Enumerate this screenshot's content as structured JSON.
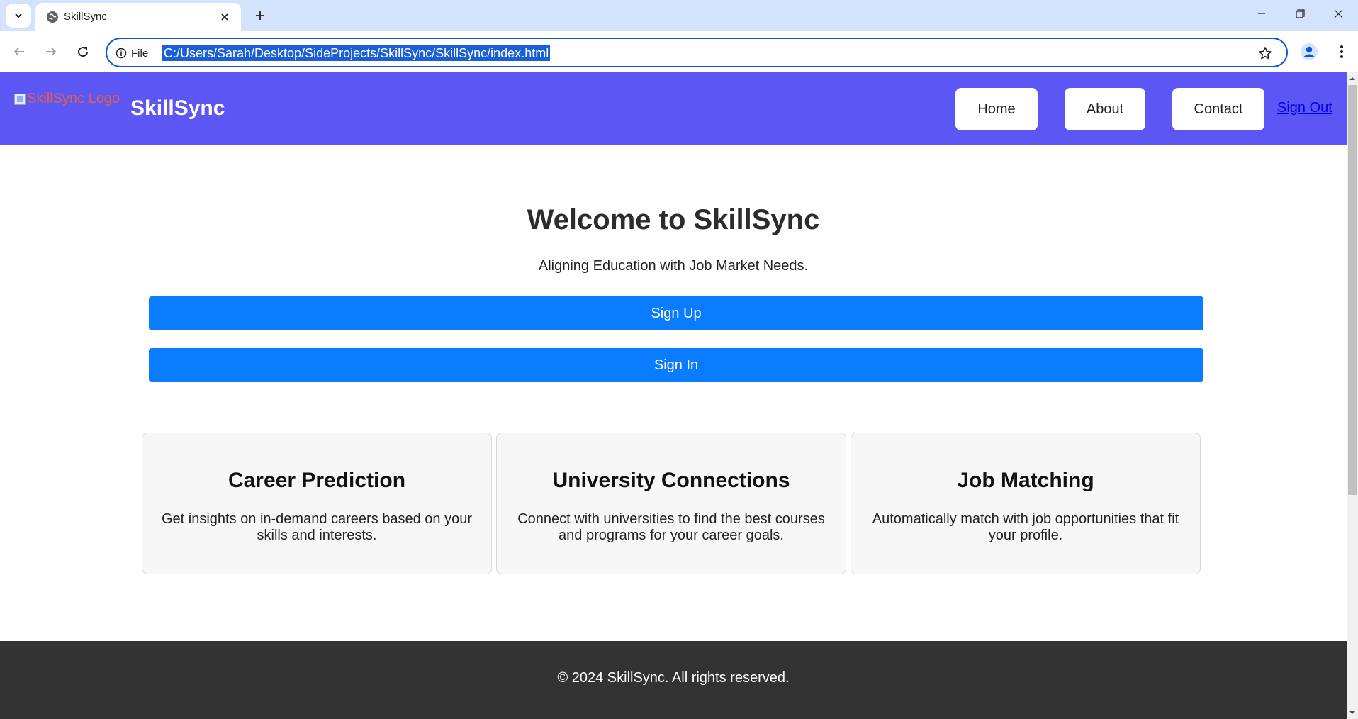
{
  "browser": {
    "tab_title": "SkillSync",
    "site_info_label": "File",
    "url": "C:/Users/Sarah/Desktop/SideProjects/SkillSync/SkillSync/index.html"
  },
  "header": {
    "logo_alt": "SkillSync Logo",
    "brand": "SkillSync",
    "nav": {
      "home": "Home",
      "about": "About",
      "contact": "Contact",
      "sign_out": "Sign Out"
    }
  },
  "hero": {
    "title": "Welcome to SkillSync",
    "subtitle": "Aligning Education with Job Market Needs.",
    "sign_up": "Sign Up",
    "sign_in": "Sign In"
  },
  "features": [
    {
      "title": "Career Prediction",
      "text": "Get insights on in-demand careers based on your skills and interests."
    },
    {
      "title": "University Connections",
      "text": "Connect with universities to find the best courses and programs for your career goals."
    },
    {
      "title": "Job Matching",
      "text": "Automatically match with job opportunities that fit your profile."
    }
  ],
  "footer": {
    "copyright": "© 2024 SkillSync. All rights reserved."
  },
  "colors": {
    "header_bg": "#5b56f4",
    "cta_bg": "#0a7cff",
    "footer_bg": "#333333",
    "card_bg": "#f7f7f7"
  }
}
